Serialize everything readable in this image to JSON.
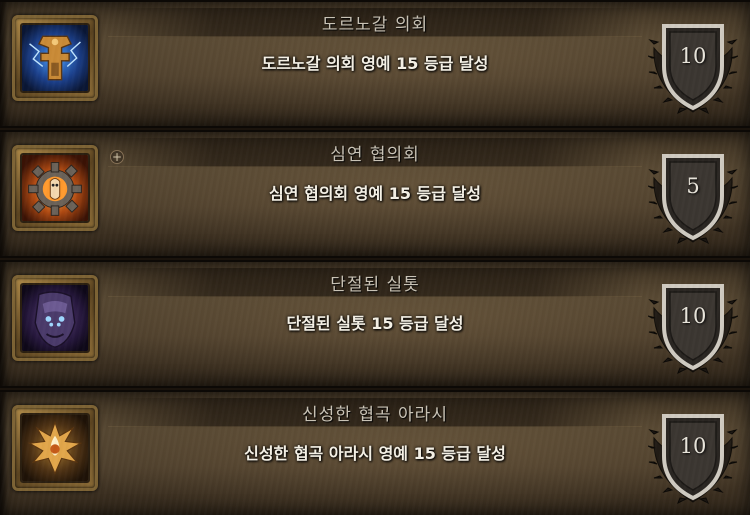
{
  "achievements": [
    {
      "title": "도르노갈 의회",
      "description": "도르노갈 의회 영예 15 등급 달성",
      "points": "10",
      "icon": "hammer-key-emblem-icon",
      "expandable": false
    },
    {
      "title": "심연 협의회",
      "description": "심연 협의회 영예 15 등급 달성",
      "points": "5",
      "icon": "gear-creature-emblem-icon",
      "expandable": true
    },
    {
      "title": "단절된 실톳",
      "description": "단절된 실톳 15 등급 달성",
      "points": "10",
      "icon": "nerubian-face-icon",
      "expandable": false
    },
    {
      "title": "신성한 협곡 아라시",
      "description": "신성한 협곡 아라시 영예 15 등급 달성",
      "points": "10",
      "icon": "flame-crest-icon",
      "expandable": false
    }
  ],
  "colors": {
    "title_text": "#c9c3b6",
    "description_text": "#f5f1e6",
    "frame_gold": "#7d6334"
  }
}
